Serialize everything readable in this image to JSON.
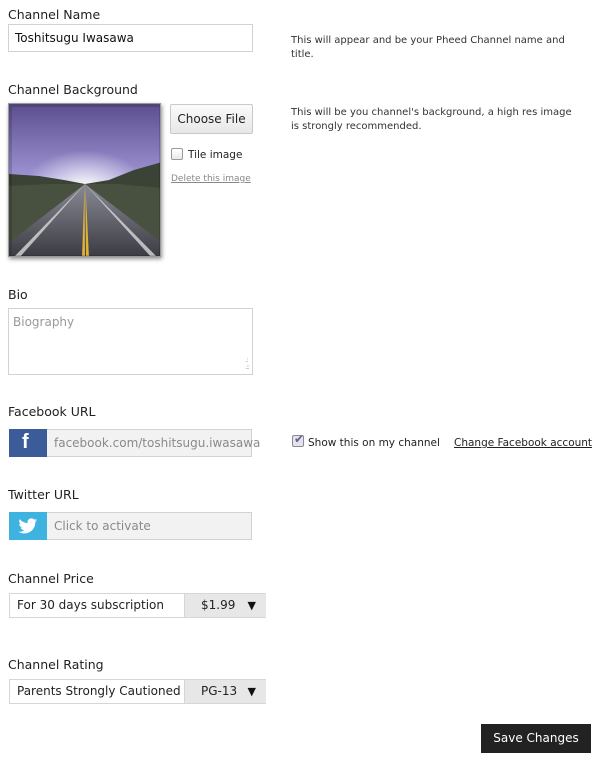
{
  "channel_name": {
    "label": "Channel Name",
    "value": "Toshitsugu Iwasawa",
    "hint": "This will appear and be your Pheed Channel name and title."
  },
  "channel_background": {
    "label": "Channel Background",
    "choose_file_label": "Choose File",
    "tile_image_label": "Tile image",
    "tile_image_checked": false,
    "delete_label": "Delete this image",
    "hint": "This will be you channel's background, a high res image is strongly recommended."
  },
  "bio": {
    "label": "Bio",
    "placeholder": "Biography"
  },
  "facebook": {
    "label": "Facebook URL",
    "icon": "facebook-icon",
    "value": "facebook.com/toshitsugu.iwasawa",
    "show_label": "Show this on my channel",
    "show_checked": true,
    "change_label": "Change Facebook account",
    "brand_color": "#3b5b99"
  },
  "twitter": {
    "label": "Twitter URL",
    "icon": "twitter-icon",
    "value": "Click to activate",
    "brand_color": "#3fb3e0"
  },
  "price": {
    "label": "Channel Price",
    "description": "For 30 days subscription",
    "selected": "$1.99"
  },
  "rating": {
    "label": "Channel Rating",
    "description": "Parents Strongly Cautioned",
    "selected": "PG-13"
  },
  "save_label": "Save Changes"
}
